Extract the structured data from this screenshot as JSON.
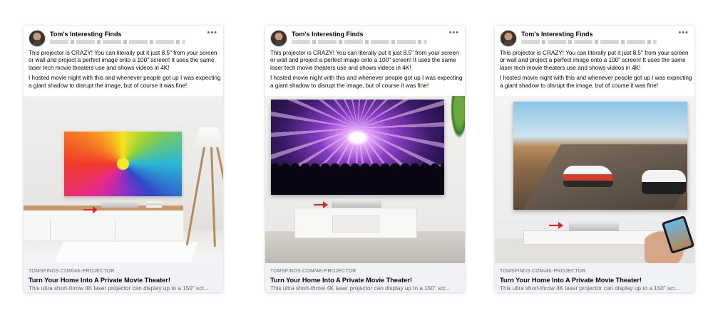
{
  "ads": [
    {
      "page_name": "Tom's Interesting Finds",
      "body": [
        "This projector is CRAZY! You can literally put it just 8.5\" from your screen or wall and project a perfect image onto a 100\" screen! It uses the same laser tech movie theaters use and shows videos in 4K!",
        "I hosted movie night with this and whenever people got up I was expecting a giant shadow to disrupt the image, but of course it was fine!"
      ],
      "domain": "TOMSFINDS.COM/4K-PROJECTOR",
      "headline": "Turn Your Home Into A Private Movie Theater!",
      "description": "This ultra short-throw 4K laser projector can display up to a 150\" scr..."
    },
    {
      "page_name": "Tom's Interesting Finds",
      "body": [
        "This projector is CRAZY! You can literally put it just 8.5\" from your screen or wall and project a perfect image onto a 100\" screen! It uses the same laser tech movie theaters use and shows videos in 4K!",
        "I hosted movie night with this and whenever people got up I was expecting a giant shadow to disrupt the image, but of course it was fine!"
      ],
      "domain": "TOMSFINDS.COM/4K-PROJECTOR",
      "headline": "Turn Your Home Into A Private Movie Theater!",
      "description": "This ultra short-throw 4K laser projector can display up to a 150\" scr..."
    },
    {
      "page_name": "Tom's Interesting Finds",
      "body": [
        "This projector is CRAZY! You can literally put it just 8.5\" from your screen or wall and project a perfect image onto a 100\" screen! It uses the same laser tech movie theaters use and shows videos in 4K!",
        "I hosted movie night with this and whenever people got up I was expecting a giant shadow to disrupt the image, but of course it was fine!"
      ],
      "domain": "TOMSFINDS.COM/4K-PROJECTOR",
      "headline": "Turn Your Home Into A Private Movie Theater!",
      "description": "This ultra short-throw 4K laser projector can display up to a 150\" scr..."
    }
  ],
  "more_icon": "more-options-icon",
  "colors": {
    "arrow": "#e2231a",
    "footer_bg": "#f0f2f5",
    "meta_text": "#65676b"
  }
}
